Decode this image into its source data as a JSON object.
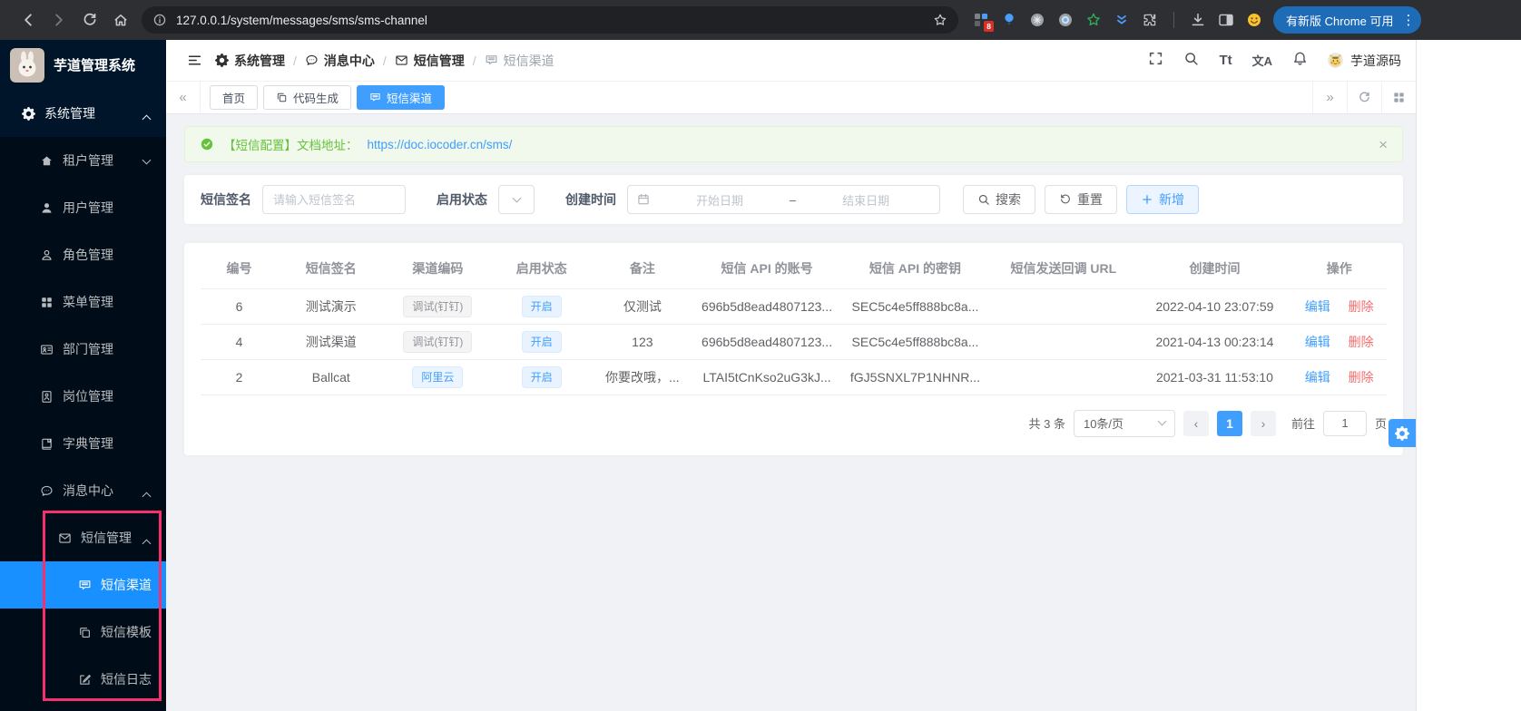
{
  "browser": {
    "url": "127.0.0.1/system/messages/sms/sms-channel",
    "update_chip": "有新版 Chrome 可用",
    "extension_badge": "8"
  },
  "sidebar": {
    "app_title": "芋道管理系统",
    "menu": [
      {
        "label": "系统管理"
      },
      {
        "label": "租户管理"
      },
      {
        "label": "用户管理"
      },
      {
        "label": "角色管理"
      },
      {
        "label": "菜单管理"
      },
      {
        "label": "部门管理"
      },
      {
        "label": "岗位管理"
      },
      {
        "label": "字典管理"
      },
      {
        "label": "消息中心"
      },
      {
        "label": "短信管理"
      },
      {
        "label": "短信渠道"
      },
      {
        "label": "短信模板"
      },
      {
        "label": "短信日志"
      }
    ]
  },
  "header": {
    "breadcrumb": [
      "系统管理",
      "消息中心",
      "短信管理",
      "短信渠道"
    ],
    "font_label": "Tt",
    "lang_label": "文A",
    "username": "芋道源码"
  },
  "tabs": [
    {
      "label": "首页"
    },
    {
      "label": "代码生成"
    },
    {
      "label": "短信渠道"
    }
  ],
  "alert": {
    "text": "【短信配置】文档地址：",
    "link": "https://doc.iocoder.cn/sms/",
    "close": "×"
  },
  "filters": {
    "signature_label": "短信签名",
    "signature_placeholder": "请输入短信签名",
    "status_label": "启用状态",
    "created_label": "创建时间",
    "date_start_placeholder": "开始日期",
    "date_separator": "–",
    "date_end_placeholder": "结束日期",
    "search_button": "搜索",
    "reset_button": "重置",
    "add_button": "新增"
  },
  "table": {
    "columns": [
      "编号",
      "短信签名",
      "渠道编码",
      "启用状态",
      "备注",
      "短信 API 的账号",
      "短信 API 的密钥",
      "短信发送回调 URL",
      "创建时间",
      "操作"
    ],
    "edit_label": "编辑",
    "delete_label": "删除",
    "rows": [
      {
        "id": "6",
        "signature": "测试演示",
        "channel": "调试(钉钉)",
        "channel_style": "info",
        "status": "开启",
        "remark": "仅测试",
        "api_account": "696b5d8ead4807123...",
        "api_secret": "SEC5c4e5ff888bc8a...",
        "callback_url": "",
        "created_at": "2022-04-10 23:07:59"
      },
      {
        "id": "4",
        "signature": "测试渠道",
        "channel": "调试(钉钉)",
        "channel_style": "info",
        "status": "开启",
        "remark": "123",
        "api_account": "696b5d8ead4807123...",
        "api_secret": "SEC5c4e5ff888bc8a...",
        "callback_url": "",
        "created_at": "2021-04-13 00:23:14"
      },
      {
        "id": "2",
        "signature": "Ballcat",
        "channel": "阿里云",
        "channel_style": "blue",
        "status": "开启",
        "remark": "你要改哦，...",
        "api_account": "LTAI5tCnKso2uG3kJ...",
        "api_secret": "fGJ5SNXL7P1NHNR...",
        "callback_url": "",
        "created_at": "2021-03-31 11:53:10"
      }
    ]
  },
  "pagination": {
    "total": "共 3 条",
    "page_size": "10条/页",
    "current_page": "1",
    "goto_label": "前往",
    "goto_value": "1",
    "page_unit": "页"
  },
  "colors": {
    "primary_blue": "#409eff",
    "menu_active_blue": "#1890ff",
    "sidebar_bg": "#001529",
    "sidebar_sub_bg": "#000c17",
    "annotation_pink": "#f5306d",
    "success_green": "#67c23a",
    "danger_red": "#f56c6c",
    "chrome_chip_blue": "#1e6bb8"
  }
}
